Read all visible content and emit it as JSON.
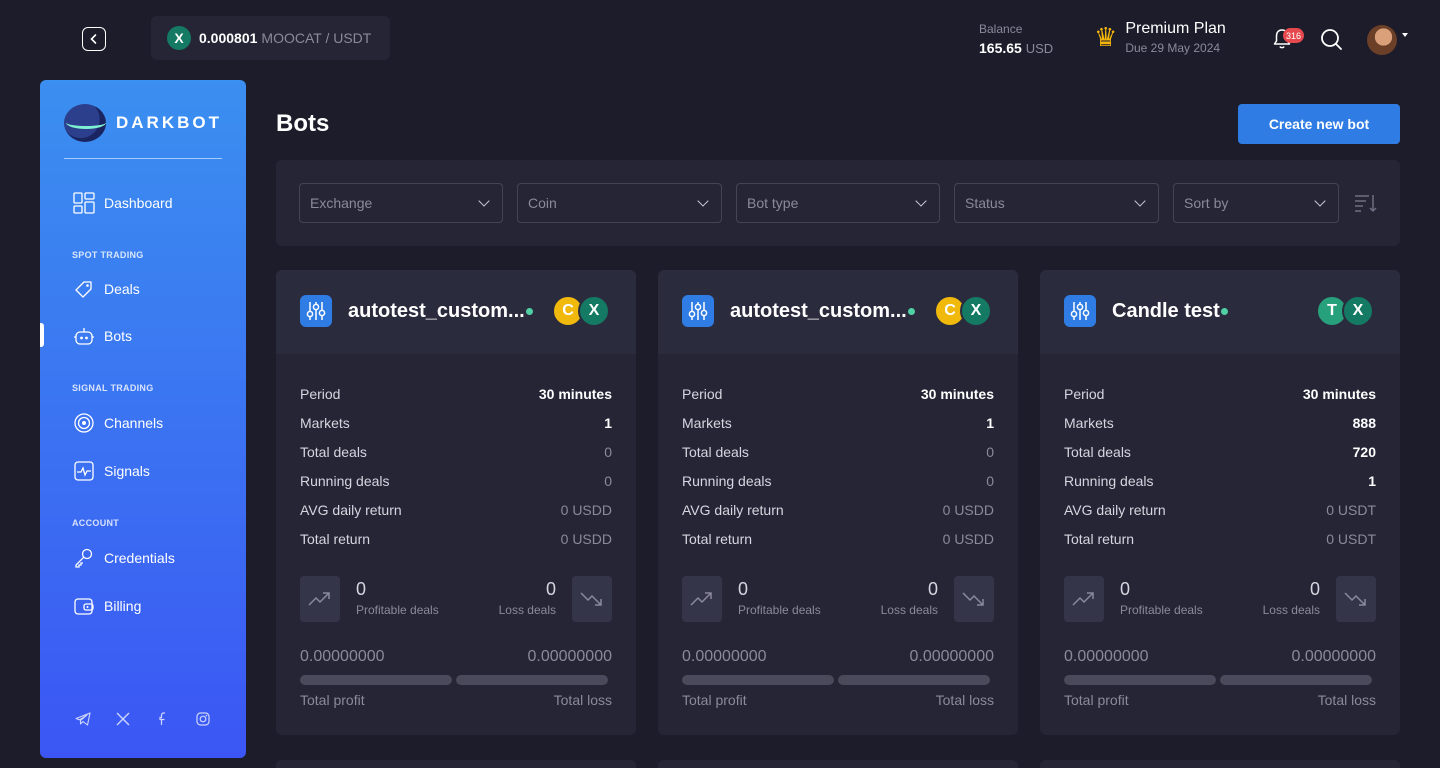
{
  "ticker": {
    "price": "0.000801",
    "pair": "MOOCAT / USDT",
    "coin_icon": "X"
  },
  "balance": {
    "label": "Balance",
    "value": "165.65",
    "currency": "USD"
  },
  "plan": {
    "name": "Premium Plan",
    "due": "Due 29 May 2024"
  },
  "notifications": {
    "count": "316"
  },
  "sidebar": {
    "logo_text": "DARKBOT",
    "items": {
      "dashboard": "Dashboard",
      "section_spot": "SPOT TRADING",
      "deals": "Deals",
      "bots": "Bots",
      "section_signal": "SIGNAL TRADING",
      "channels": "Channels",
      "signals": "Signals",
      "section_account": "ACCOUNT",
      "credentials": "Credentials",
      "billing": "Billing"
    }
  },
  "page": {
    "title": "Bots",
    "create_button": "Create new bot"
  },
  "filters": {
    "exchange": "Exchange",
    "coin": "Coin",
    "bot_type": "Bot type",
    "status": "Status",
    "sort_by": "Sort by"
  },
  "labels": {
    "period": "Period",
    "markets": "Markets",
    "total_deals": "Total deals",
    "running_deals": "Running deals",
    "avg_daily_return": "AVG daily return",
    "total_return": "Total return",
    "profitable_deals": "Profitable deals",
    "loss_deals": "Loss deals",
    "total_profit": "Total profit",
    "total_loss": "Total loss"
  },
  "cards": [
    {
      "name": "autotest_custom...",
      "coin_a": "C",
      "coin_b": "X",
      "period": "30 minutes",
      "markets": "1",
      "total_deals": "0",
      "running_deals": "0",
      "avg_daily_return": "0 USDD",
      "total_return": "0 USDD",
      "profitable_count": "0",
      "loss_count": "0",
      "profit_amount": "0.00000000",
      "loss_amount": "0.00000000"
    },
    {
      "name": "autotest_custom...",
      "coin_a": "C",
      "coin_b": "X",
      "period": "30 minutes",
      "markets": "1",
      "total_deals": "0",
      "running_deals": "0",
      "avg_daily_return": "0 USDD",
      "total_return": "0 USDD",
      "profitable_count": "0",
      "loss_count": "0",
      "profit_amount": "0.00000000",
      "loss_amount": "0.00000000"
    },
    {
      "name": "Candle test",
      "coin_a": "T",
      "coin_b": "X",
      "period": "30 minutes",
      "markets": "888",
      "total_deals": "720",
      "running_deals": "1",
      "avg_daily_return": "0 USDT",
      "total_return": "0 USDT",
      "profitable_count": "0",
      "loss_count": "0",
      "profit_amount": "0.00000000",
      "loss_amount": "0.00000000"
    }
  ],
  "colors": {
    "accent": "#2f7de4",
    "status_active": "#4fd1a5",
    "badge": "#e5484d"
  }
}
